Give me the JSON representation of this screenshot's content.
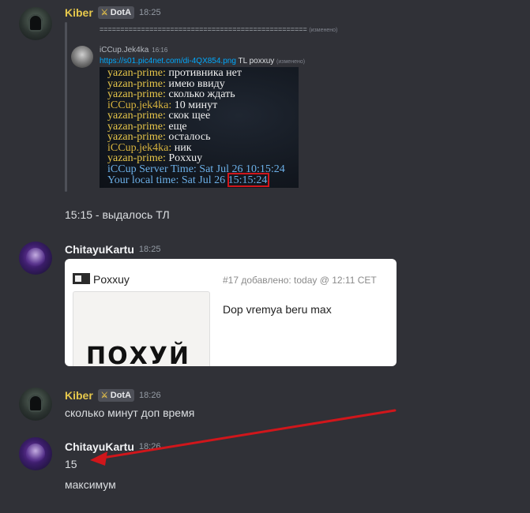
{
  "messages": {
    "kiber1": {
      "author": "Kiber",
      "tag": "DotA",
      "time": "18:25",
      "separator": "==================================================",
      "separator_edited": "(изменено)",
      "forward": {
        "author": "iCCup.Jek4ka",
        "time": "16:16",
        "link": "https://s01.pic4net.com/di-4QX854.png",
        "link_tail": "TL poxxuy",
        "edited": "(изменено)"
      },
      "chat_log": [
        {
          "name": "yazan-prime:",
          "text": " противника нет",
          "kind": "y"
        },
        {
          "name": "yazan-prime:",
          "text": " имею ввиду",
          "kind": "y"
        },
        {
          "name": "yazan-prime:",
          "text": " сколько ждать",
          "kind": "y"
        },
        {
          "name": "iCCup.jek4ka:",
          "text": " 10 минут",
          "kind": "c"
        },
        {
          "name": "yazan-prime:",
          "text": " скок щее",
          "kind": "y"
        },
        {
          "name": "yazan-prime:",
          "text": " еще",
          "kind": "y"
        },
        {
          "name": "yazan-prime:",
          "text": " осталось",
          "kind": "y"
        },
        {
          "name": "iCCup.jek4ka:",
          "text": " ник",
          "kind": "c"
        },
        {
          "name": "yazan-prime:",
          "text": " Poxxuy",
          "kind": "y"
        }
      ],
      "server_time": "iCCup Server Time: Sat Jul 26 10:15:24",
      "local_time": "Your local time: Sat Jul 26 15:15:24",
      "caption": "15:15 - выдалось ТЛ"
    },
    "chitayu1": {
      "author": "ChitayuKartu",
      "time": "18:25",
      "embed": {
        "title": "Poxxuy",
        "meta": "#17 добавлено: today @ 12:11 CET",
        "body": "Dop vremya beru max",
        "thumb_text": "ПОХУЙ"
      }
    },
    "kiber2": {
      "author": "Kiber",
      "tag": "DotA",
      "time": "18:26",
      "text": "сколько минут доп время"
    },
    "chitayu2": {
      "author": "ChitayuKartu",
      "time": "18:26",
      "line1": "15",
      "line2": "максимум"
    }
  },
  "colors": {
    "background": "#303137",
    "kiber_name": "#e6c84c",
    "link": "#00a8fc",
    "annotation_red": "#d0161b"
  },
  "icons": [
    "dota-badge-icon",
    "bot-embed-icon",
    "red-arrow-annotation"
  ]
}
